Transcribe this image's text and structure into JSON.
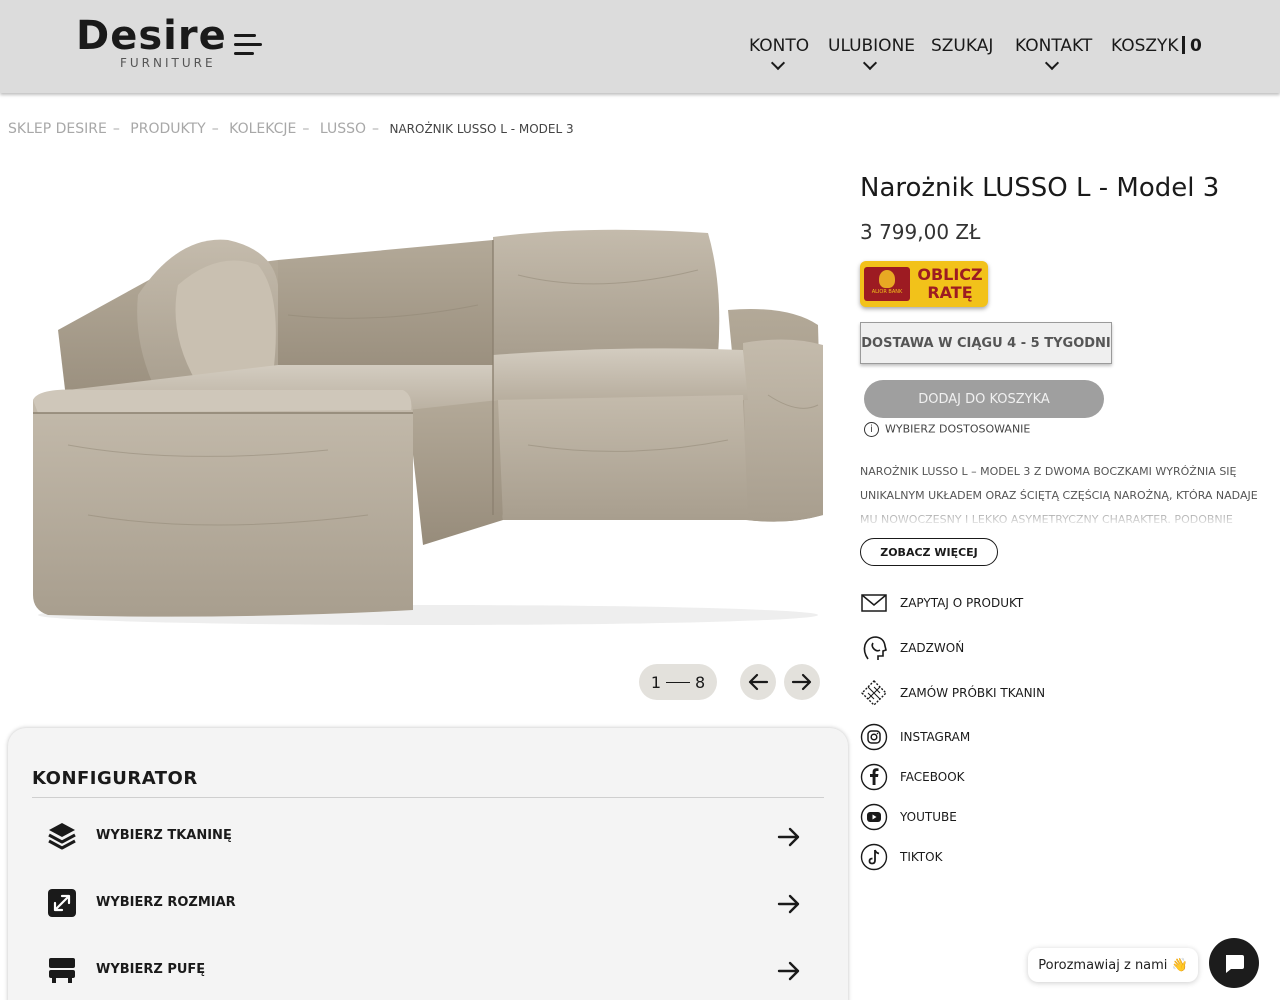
{
  "header": {
    "logo_main": "Desire",
    "logo_sub": "FURNITURE",
    "nav": [
      {
        "label": "KONTO"
      },
      {
        "label": "ULUBIONE"
      },
      {
        "label": "SZUKAJ"
      },
      {
        "label": "KONTAKT"
      },
      {
        "label": "KOSZYK"
      }
    ],
    "cart_count": "0"
  },
  "breadcrumb": {
    "items": [
      "SKLEP DESIRE",
      "PRODUKTY",
      "KOLEKCJE",
      "LUSSO"
    ],
    "separator": "–",
    "current": "NAROŻNIK LUSSO L - MODEL 3"
  },
  "gallery": {
    "current": "1",
    "total": "8"
  },
  "configurator": {
    "title": "KONFIGURATOR",
    "rows": [
      {
        "label": "WYBIERZ TKANINĘ",
        "icon": "layers-icon"
      },
      {
        "label": "WYBIERZ ROZMIAR",
        "icon": "resize-icon"
      },
      {
        "label": "WYBIERZ PUFĘ",
        "icon": "pouf-icon"
      }
    ]
  },
  "product": {
    "title": "Narożnik LUSSO L - Model 3",
    "price": "3 799,00 ZŁ",
    "rate_button": {
      "line1": "OBLICZ",
      "line2": "RATĘ",
      "bank": "ALIOR BANK"
    },
    "delivery": "DOSTAWA W CIĄGU 4 - 5 TYGODNI",
    "add_to_cart": "DODAJ DO KOSZYKA",
    "customize_hint": "WYBIERZ DOSTOSOWANIE",
    "description": "NAROŻNIK LUSSO L – MODEL 3 Z DWOMA BOCZKAMI WYRÓŻNIA SIĘ UNIKALNYM UKŁADEM ORAZ ŚCIĘTĄ CZĘŚCIĄ NAROŻNĄ, KTÓRA NADAJE MU NOWOCZESNY I LEKKO ASYMETRYCZNY CHARAKTER. PODOBNIE",
    "see_more": "ZOBACZ WIĘCEJ"
  },
  "side_links": [
    {
      "label": "ZAPYTAJ O PRODUKT",
      "icon": "mail-icon"
    },
    {
      "label": "ZADZWOŃ",
      "icon": "phone-head-icon"
    },
    {
      "label": "ZAMÓW PRÓBKI TKANIN",
      "icon": "fabric-sample-icon"
    },
    {
      "label": "INSTAGRAM",
      "icon": "instagram-icon"
    },
    {
      "label": "FACEBOOK",
      "icon": "facebook-icon"
    },
    {
      "label": "YOUTUBE",
      "icon": "youtube-icon"
    },
    {
      "label": "TIKTOK",
      "icon": "tiktok-icon"
    }
  ],
  "chat": {
    "label": "Porozmawiaj z nami 👋"
  },
  "colors": {
    "header_bg": "#dcdcdc",
    "rate_yellow": "#f2c21a",
    "rate_red": "#9d1b22",
    "add_to_cart_bg": "#9f9f9f",
    "sofa_fabric": "#b8ae9e"
  }
}
